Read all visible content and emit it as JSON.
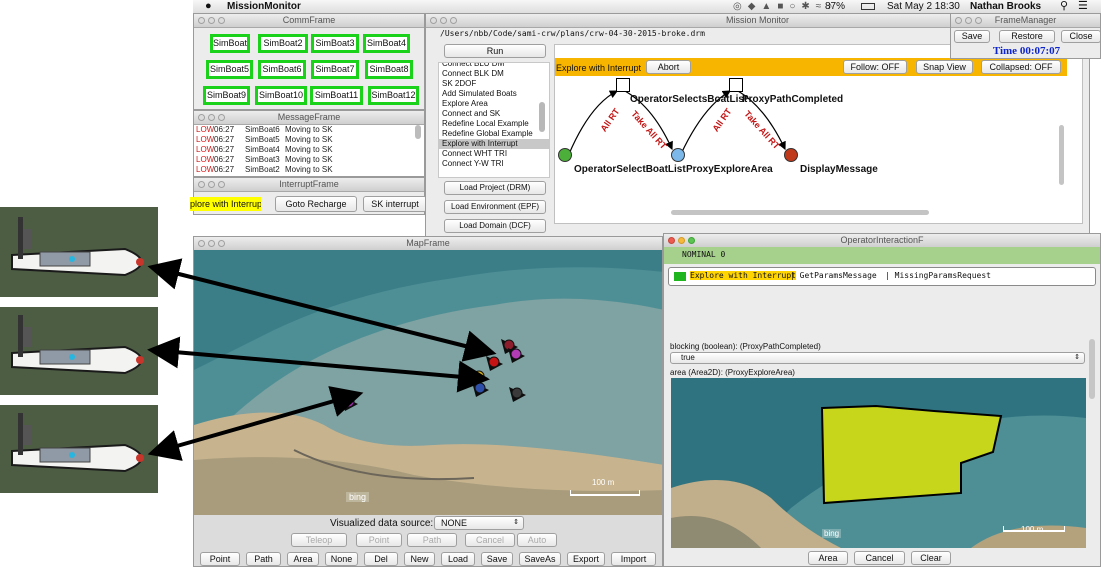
{
  "menubar": {
    "app_name": "MissionMonitor",
    "battery": "87%",
    "datetime": "Sat May 2  18:30",
    "user": "Nathan Brooks"
  },
  "comm_frame": {
    "title": "CommFrame",
    "boats": [
      "SimBoat",
      "SimBoat2",
      "SimBoat3",
      "SimBoat4",
      "SimBoat5",
      "SimBoat6",
      "SimBoat7",
      "SimBoat8",
      "SimBoat9",
      "SimBoat10",
      "SimBoat11",
      "SimBoat12"
    ],
    "status_color": "#19d219"
  },
  "message_frame": {
    "title": "MessageFrame",
    "rows": [
      {
        "level": "LOW",
        "time": "06:27",
        "source": "SimBoat6",
        "text": "Moving to SK"
      },
      {
        "level": "LOW",
        "time": "06:27",
        "source": "SimBoat5",
        "text": "Moving to SK"
      },
      {
        "level": "LOW",
        "time": "06:27",
        "source": "SimBoat4",
        "text": "Moving to SK"
      },
      {
        "level": "LOW",
        "time": "06:27",
        "source": "SimBoat3",
        "text": "Moving to SK"
      },
      {
        "level": "LOW",
        "time": "06:27",
        "source": "SimBoat2",
        "text": "Moving to SK"
      }
    ]
  },
  "interrupt_frame": {
    "title": "InterruptFrame",
    "active_label": "plore with Interrupt",
    "buttons": [
      "Goto Recharge",
      "SK interrupt"
    ]
  },
  "mission_monitor": {
    "title": "Mission Monitor",
    "path": "/Users/nbb/Code/sami-crw/plans/crw-04-30-2015-broke.drm",
    "run_label": "Run",
    "plans": [
      "Connect BLU DM",
      "Connect BLK DM",
      "SK 2DOF",
      "Add Simulated Boats",
      "Explore Area",
      "Connect and SK",
      "Redefine Local Example",
      "Redefine Global Example",
      "Explore with Interrupt",
      "Connect WHT TRI",
      "Connect Y-W TRI"
    ],
    "selected_plan": "Explore with Interrupt",
    "load_buttons": [
      "Load Project (DRM)",
      "Load Environment (EPF)",
      "Load Domain (DCF)"
    ],
    "toolbar": {
      "plan_label": "Explore with Interrupt",
      "abort": "Abort",
      "follow": "Follow: OFF",
      "snap": "Snap View",
      "collapsed": "Collapsed: OFF"
    },
    "graph": {
      "nodes": [
        "OperatorSelectBoatList",
        "ProxyExploreArea",
        "DisplayMessage"
      ],
      "transitions": [
        "OperatorSelectsBoatList",
        "ProxyPathCompleted"
      ],
      "edge_labels": [
        "All RT",
        "Take All RT",
        "All RT",
        "Take All RT"
      ],
      "node_colors": [
        "#4caf3a",
        "#7cb8ea",
        "#c0391b"
      ]
    }
  },
  "frame_manager": {
    "title": "FrameManager",
    "buttons": [
      "Save",
      "Restore",
      "Close"
    ],
    "time": "Time 00:07:07"
  },
  "map_frame": {
    "title": "MapFrame",
    "source_label": "Visualized data source:",
    "source_value": "NONE",
    "scale": "100 m",
    "watermark": "bing",
    "row1": [
      "Teleop",
      "Point",
      "Path",
      "Cancel",
      "Auto"
    ],
    "row2": [
      "Point",
      "Path",
      "Area",
      "None",
      "Del",
      "New",
      "Load",
      "Save",
      "SaveAs",
      "Export",
      "Import"
    ],
    "boat_colors": [
      "#8b1d2c",
      "#b13ab5",
      "#c51414",
      "#3a3a3a",
      "#2d4ea8",
      "#d7b020",
      "#9c2ea8"
    ]
  },
  "operator_frame": {
    "title": "OperatorInteractionF",
    "status": "NOMINAL 0",
    "list_row": {
      "plan": "Explore with Interrupt",
      "message": "| GetParamsMessage",
      "request": "| MissingParamsRequest"
    },
    "blocking_label": "blocking (boolean): (ProxyPathCompleted)",
    "blocking_value": "true",
    "area_label": "area (Area2D): (ProxyExploreArea)",
    "scale": "100 m",
    "watermark": "bing",
    "area_color": "#c7d61a",
    "buttons": [
      "Area",
      "Cancel",
      "Clear"
    ]
  }
}
